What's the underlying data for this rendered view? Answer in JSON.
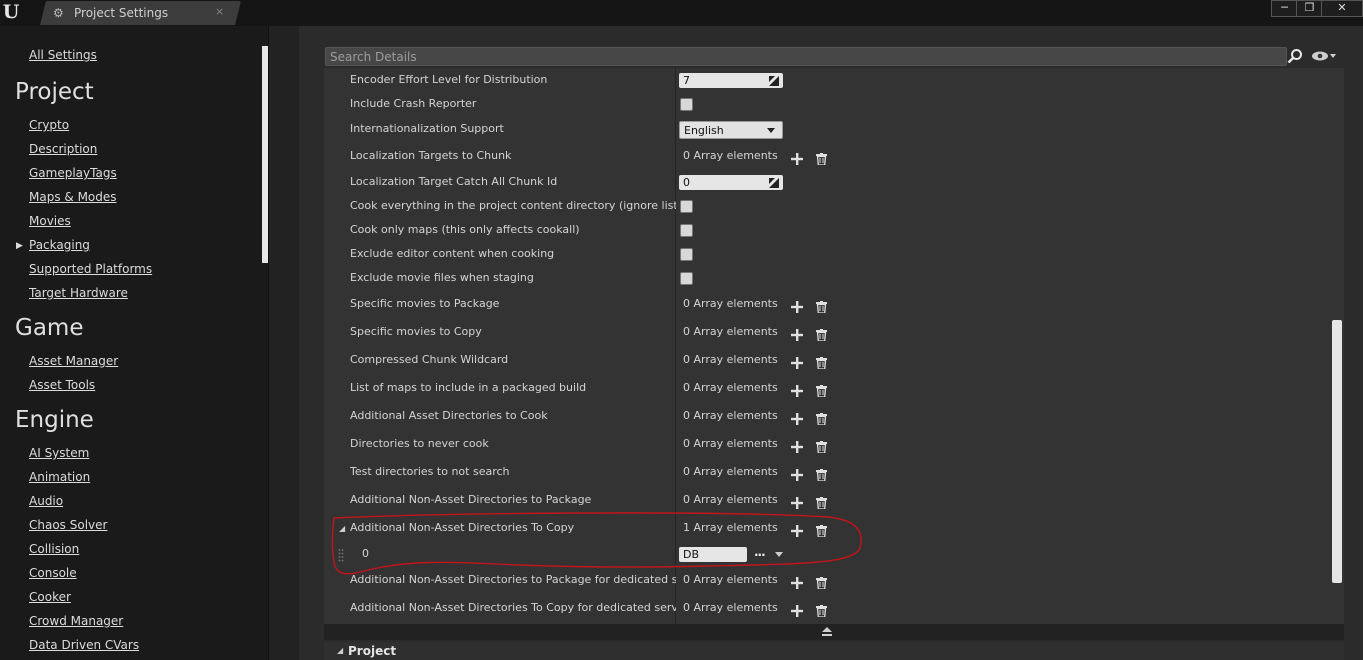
{
  "window": {
    "tab_title": "Project Settings",
    "tab_close": "×",
    "controls": {
      "minimize": "─",
      "restore": "❐",
      "close": "✕"
    }
  },
  "nav": {
    "all_settings": "All Settings",
    "project_heading": "Project",
    "project_items": [
      "Crypto",
      "Description",
      "GameplayTags",
      "Maps & Modes",
      "Movies",
      "Packaging",
      "Supported Platforms",
      "Target Hardware"
    ],
    "game_heading": "Game",
    "game_items": [
      "Asset Manager",
      "Asset Tools"
    ],
    "engine_heading": "Engine",
    "engine_items": [
      "AI System",
      "Animation",
      "Audio",
      "Chaos Solver",
      "Collision",
      "Console",
      "Cooker",
      "Crowd Manager",
      "Data Driven CVars"
    ]
  },
  "search": {
    "placeholder": "Search Details"
  },
  "rows": [
    {
      "label": "Encoder Effort Level for Distribution",
      "type": "number",
      "value": "7"
    },
    {
      "label": "Include Crash Reporter",
      "type": "checkbox",
      "checked": false
    },
    {
      "label": "Internationalization Support",
      "type": "combo",
      "value": "English"
    },
    {
      "label": "Localization Targets to Chunk",
      "type": "array",
      "value": "0 Array elements"
    },
    {
      "label": "Localization Target Catch All Chunk Id",
      "type": "number",
      "value": "0"
    },
    {
      "label": "Cook everything in the project content directory (ignore list of ma",
      "type": "checkbox",
      "checked": false
    },
    {
      "label": "Cook only maps (this only affects cookall)",
      "type": "checkbox",
      "checked": false
    },
    {
      "label": "Exclude editor content when cooking",
      "type": "checkbox",
      "checked": false
    },
    {
      "label": "Exclude movie files when staging",
      "type": "checkbox",
      "checked": false
    },
    {
      "label": "Specific movies to Package",
      "type": "array",
      "value": "0 Array elements"
    },
    {
      "label": "Specific movies to Copy",
      "type": "array",
      "value": "0 Array elements"
    },
    {
      "label": "Compressed Chunk Wildcard",
      "type": "array",
      "value": "0 Array elements"
    },
    {
      "label": "List of maps to include in a packaged build",
      "type": "array",
      "value": "0 Array elements"
    },
    {
      "label": "Additional Asset Directories to Cook",
      "type": "array",
      "value": "0 Array elements"
    },
    {
      "label": "Directories to never cook",
      "type": "array",
      "value": "0 Array elements"
    },
    {
      "label": "Test directories to not search",
      "type": "array",
      "value": "0 Array elements"
    },
    {
      "label": "Additional Non-Asset Directories to Package",
      "type": "array",
      "value": "0 Array elements"
    },
    {
      "label": "Additional Non-Asset Directories To Copy",
      "type": "array",
      "value": "1 Array elements",
      "expanded": true
    },
    {
      "label": "0",
      "type": "element",
      "value": "DB",
      "browse": "..."
    },
    {
      "label": "Additional Non-Asset Directories to Package for dedicated serve",
      "type": "array",
      "value": "0 Array elements"
    },
    {
      "label": "Additional Non-Asset Directories To Copy for dedicated server or",
      "type": "array",
      "value": "0 Array elements"
    }
  ],
  "section": {
    "title": "Project"
  },
  "colors": {
    "annotation": "#c0151b",
    "panel": "#333333",
    "background": "#1a1a1a"
  }
}
